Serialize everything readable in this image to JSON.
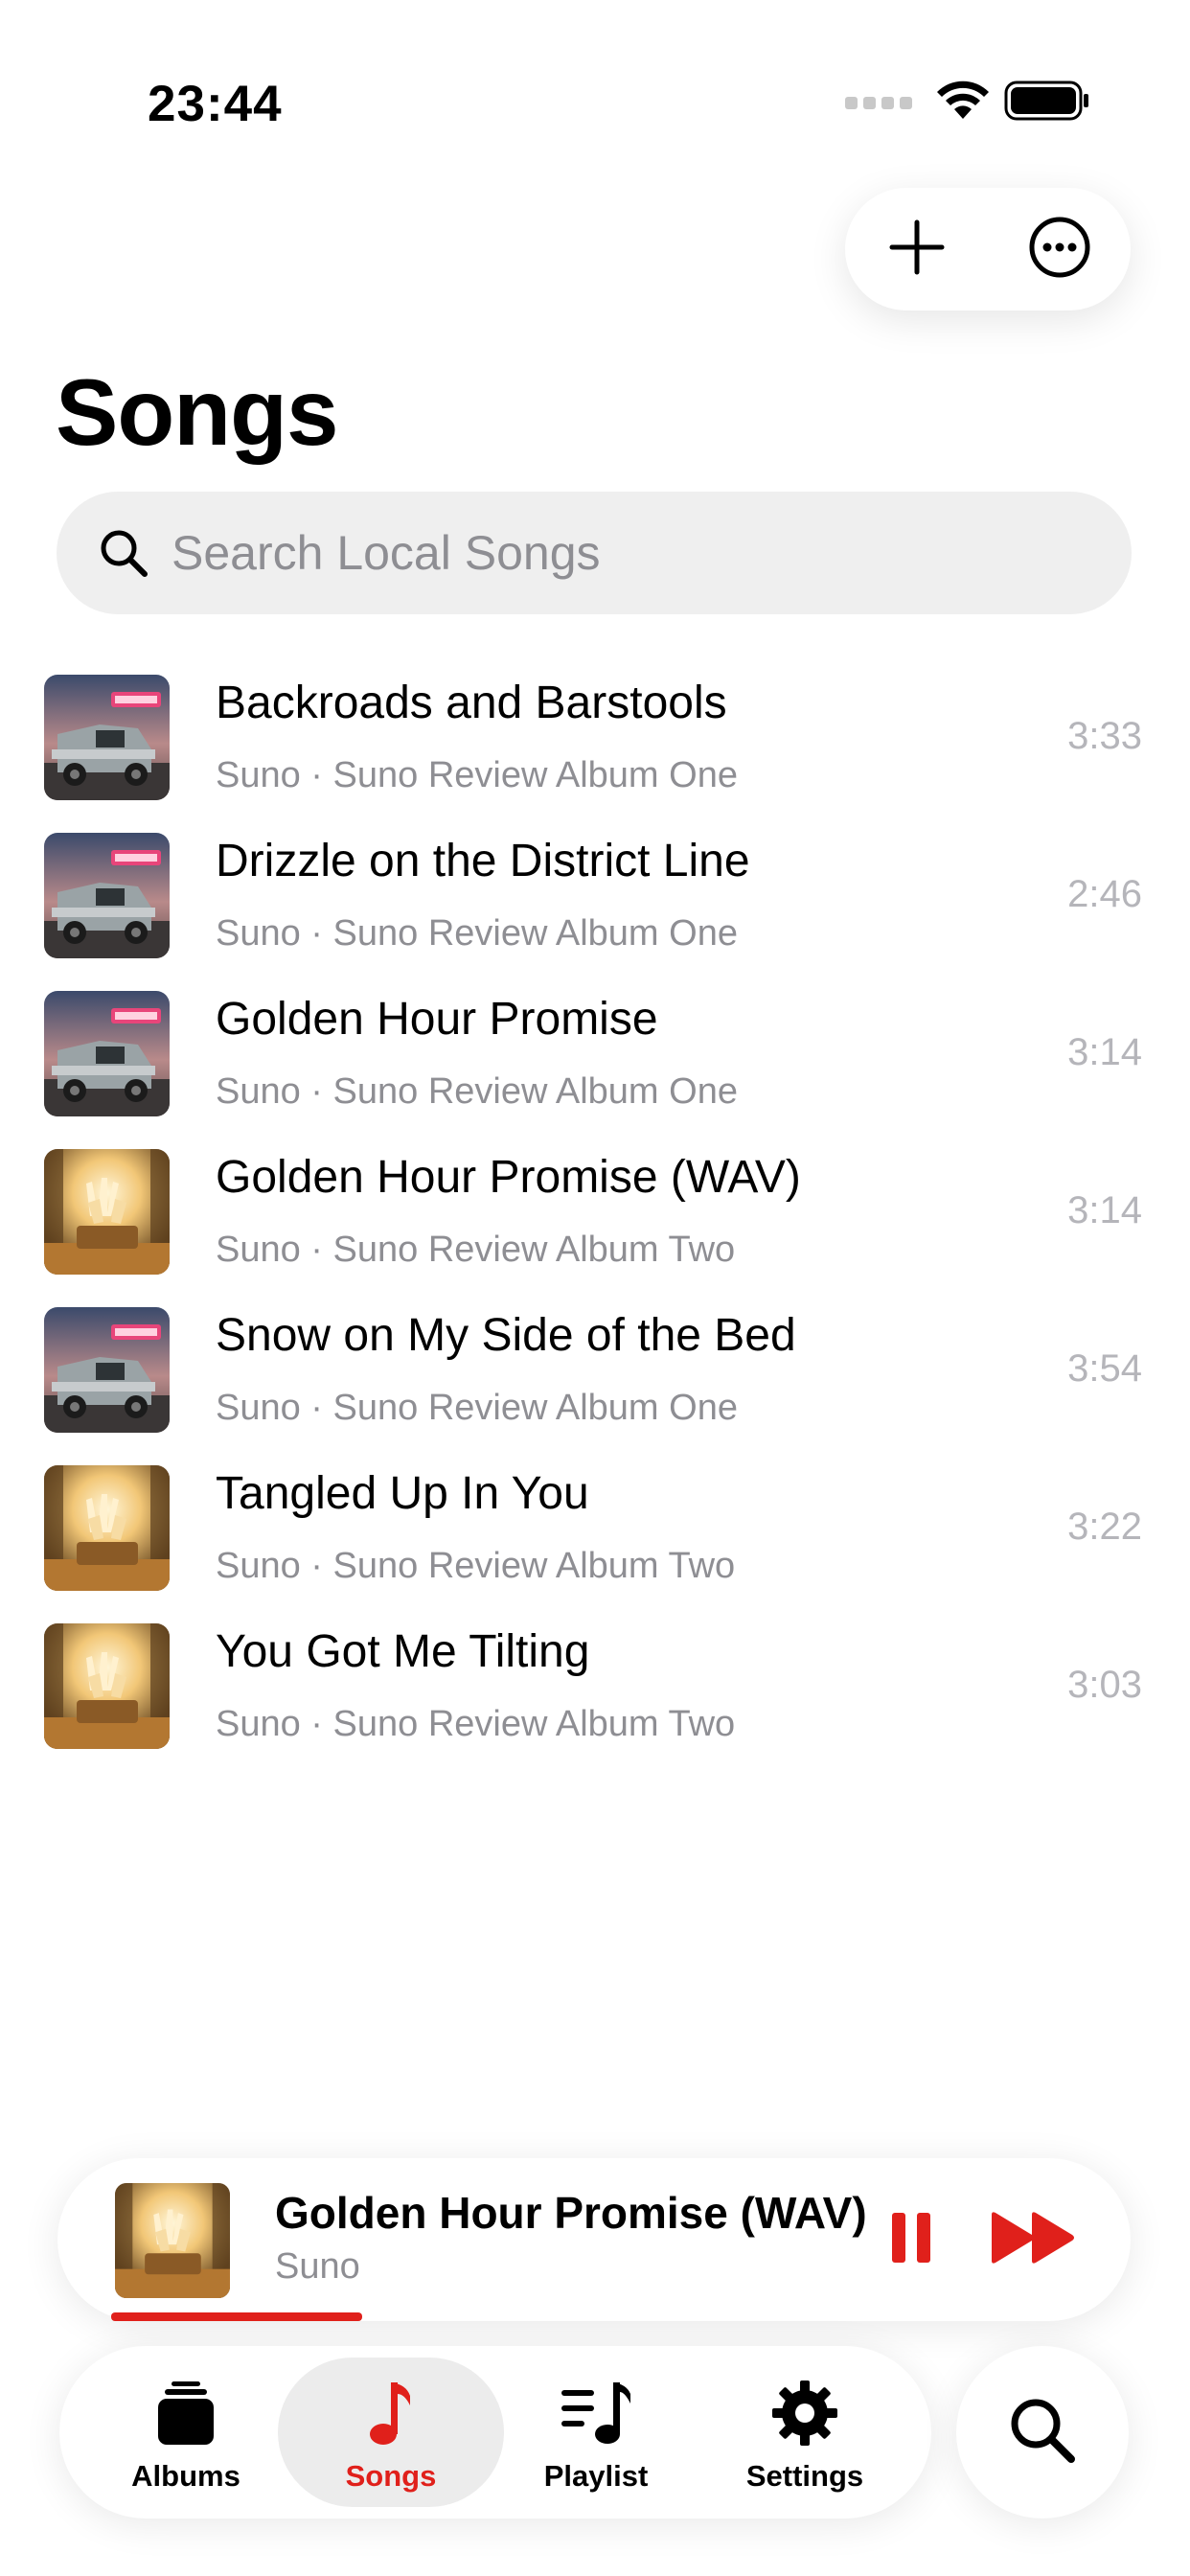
{
  "status_bar": {
    "time": "23:44"
  },
  "header": {
    "title": "Songs",
    "add_icon": "plus-icon",
    "more_icon": "ellipsis-circle-icon"
  },
  "search": {
    "placeholder": "Search Local Songs",
    "value": ""
  },
  "songs": [
    {
      "title": "Backroads and Barstools",
      "subtitle": "Suno · Suno Review Album One",
      "duration": "3:33",
      "art": "album-one-art"
    },
    {
      "title": "Drizzle on the District Line",
      "subtitle": "Suno · Suno Review Album One",
      "duration": "2:46",
      "art": "album-one-art"
    },
    {
      "title": "Golden Hour Promise",
      "subtitle": "Suno · Suno Review Album One",
      "duration": "3:14",
      "art": "album-one-art"
    },
    {
      "title": "Golden Hour Promise (WAV)",
      "subtitle": "Suno · Suno Review Album Two",
      "duration": "3:14",
      "art": "album-two-art"
    },
    {
      "title": "Snow on My Side of the Bed",
      "subtitle": "Suno · Suno Review Album One",
      "duration": "3:54",
      "art": "album-one-art"
    },
    {
      "title": "Tangled Up In You",
      "subtitle": "Suno · Suno Review Album Two",
      "duration": "3:22",
      "art": "album-two-art"
    },
    {
      "title": "You Got Me Tilting",
      "subtitle": "Suno · Suno Review Album Two",
      "duration": "3:03",
      "art": "album-two-art"
    }
  ],
  "now_playing": {
    "title": "Golden Hour Promise (WAV)",
    "artist": "Suno",
    "progress": 0.26,
    "is_playing": true,
    "art": "album-two-art"
  },
  "tab_bar": {
    "tabs": [
      {
        "label": "Albums",
        "icon": "albums-stack-icon",
        "active": false
      },
      {
        "label": "Songs",
        "icon": "music-note-icon",
        "active": true
      },
      {
        "label": "Playlist",
        "icon": "playlist-icon",
        "active": false
      },
      {
        "label": "Settings",
        "icon": "gear-icon",
        "active": false
      }
    ],
    "search_icon": "search-icon"
  },
  "colors": {
    "accent": "#e0201b",
    "secondary_text": "#8e8e93",
    "duration_text": "#b5b5ba",
    "search_bg": "#efefef",
    "active_tab_bg": "#ececec"
  }
}
